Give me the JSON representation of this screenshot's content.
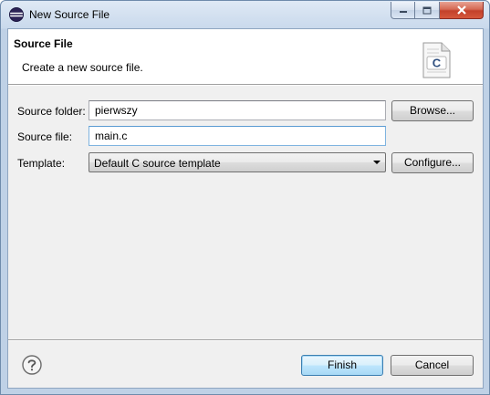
{
  "window": {
    "title": "New Source File",
    "app_icon": "eclipse-icon"
  },
  "banner": {
    "title": "Source File",
    "description": "Create a new source file.",
    "image": "c-source-file-icon",
    "image_letter": "C"
  },
  "form": {
    "source_folder_label": "Source folder:",
    "source_folder_value": "pierwszy",
    "source_file_label": "Source file:",
    "source_file_value": "main.c",
    "template_label": "Template:",
    "template_value": "Default C source template"
  },
  "buttons": {
    "browse": "Browse...",
    "configure": "Configure...",
    "finish": "Finish",
    "cancel": "Cancel"
  },
  "icons": {
    "help": "help-icon",
    "minimize": "minimize-icon",
    "maximize": "maximize-icon",
    "close": "close-icon"
  },
  "colors": {
    "title_bar": "#c9d9ec",
    "close_button": "#c3402a",
    "default_button_border": "#3c7fb1",
    "focused_input_border": "#5a9bd2"
  }
}
